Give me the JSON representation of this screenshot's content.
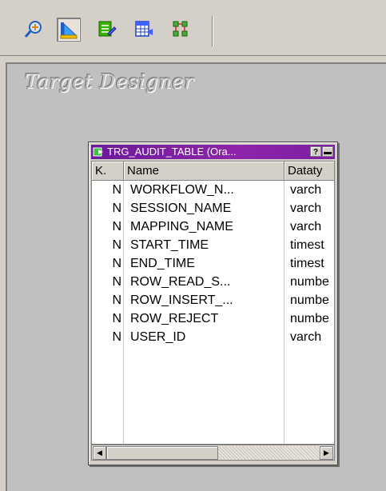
{
  "toolbar": {
    "buttons": [
      {
        "icon": "find-icon",
        "active": false
      },
      {
        "icon": "target-designer-icon",
        "active": true
      },
      {
        "icon": "edit-table-icon",
        "active": false
      },
      {
        "icon": "table-grid-icon",
        "active": false
      },
      {
        "icon": "hierarchy-icon",
        "active": false
      }
    ]
  },
  "workspace": {
    "title": "Target Designer"
  },
  "table_window": {
    "title": "TRG_AUDIT_TABLE (Ora...",
    "help_button": "?",
    "minimize_button": "▬",
    "columns": [
      "K.",
      "Name",
      "Datatype"
    ],
    "column_headers_visible": [
      "K.",
      "Name",
      "Dataty"
    ],
    "rows": [
      {
        "key": "N",
        "name": "WORKFLOW_N...",
        "type": "varch"
      },
      {
        "key": "N",
        "name": "SESSION_NAME",
        "type": "varch"
      },
      {
        "key": "N",
        "name": "MAPPING_NAME",
        "type": "varch"
      },
      {
        "key": "N",
        "name": "START_TIME",
        "type": "timest"
      },
      {
        "key": "N",
        "name": "END_TIME",
        "type": "timest"
      },
      {
        "key": "N",
        "name": "ROW_READ_S...",
        "type": "numbe"
      },
      {
        "key": "N",
        "name": "ROW_INSERT_...",
        "type": "numbe"
      },
      {
        "key": "N",
        "name": "ROW_REJECT",
        "type": "numbe"
      },
      {
        "key": "N",
        "name": "USER_ID",
        "type": "varch"
      }
    ]
  },
  "colors": {
    "titlebar": "#7b1fa2",
    "window_bg": "#d4d0c8",
    "workspace_bg": "#c0c0c0"
  }
}
